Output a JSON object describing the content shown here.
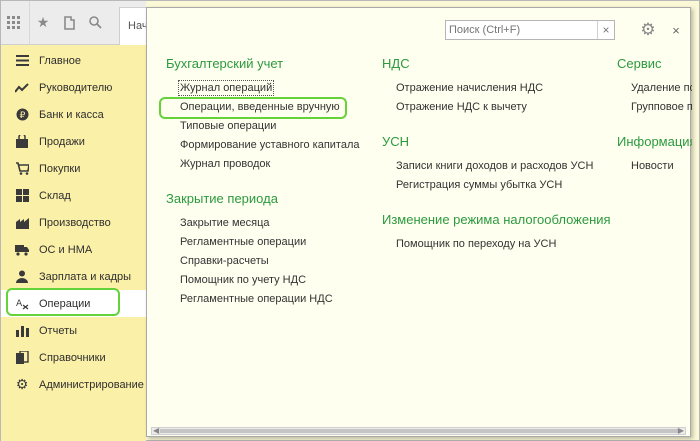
{
  "toolbar": {
    "icons": [
      "grid-icon",
      "star-icon",
      "history-icon",
      "search-icon"
    ],
    "tab_label": "Нач"
  },
  "sidebar": {
    "items": [
      {
        "label": "Главное",
        "icon": "menu-lines-icon"
      },
      {
        "label": "Руководителю",
        "icon": "trend-icon"
      },
      {
        "label": "Банк и касса",
        "icon": "coin-icon"
      },
      {
        "label": "Продажи",
        "icon": "bag-icon"
      },
      {
        "label": "Покупки",
        "icon": "cart-icon"
      },
      {
        "label": "Склад",
        "icon": "warehouse-icon"
      },
      {
        "label": "Производство",
        "icon": "factory-icon"
      },
      {
        "label": "ОС и НМА",
        "icon": "truck-icon"
      },
      {
        "label": "Зарплата и кадры",
        "icon": "person-icon"
      },
      {
        "label": "Операции",
        "icon": "operations-icon"
      },
      {
        "label": "Отчеты",
        "icon": "bar-chart-icon"
      },
      {
        "label": "Справочники",
        "icon": "books-icon"
      },
      {
        "label": "Администрирование",
        "icon": "gear-icon"
      }
    ],
    "active": "Операции"
  },
  "panel": {
    "search_placeholder": "Поиск (Ctrl+F)",
    "clear_symbol": "×",
    "close_symbol": "×",
    "sections": {
      "accounting": {
        "title": "Бухгалтерский учет",
        "links": [
          "Журнал операций",
          "Операции, введенные вручную",
          "Типовые операции",
          "Формирование уставного капитала",
          "Журнал проводок"
        ]
      },
      "period_close": {
        "title": "Закрытие периода",
        "links": [
          "Закрытие месяца",
          "Регламентные операции",
          "Справки-расчеты",
          "Помощник по учету НДС",
          "Регламентные операции НДС"
        ]
      },
      "vat": {
        "title": "НДС",
        "links": [
          "Отражение начисления НДС",
          "Отражение НДС к вычету"
        ]
      },
      "usn": {
        "title": "УСН",
        "links": [
          "Записи книги доходов и расходов УСН",
          "Регистрация суммы убытка УСН"
        ]
      },
      "tax_mode": {
        "title": "Изменение режима налогообложения",
        "links": [
          "Помощник по переходу на УСН"
        ]
      },
      "service": {
        "title": "Сервис",
        "links": [
          "Удаление пом",
          "Групповое пе"
        ]
      },
      "info": {
        "title": "Информация",
        "links": [
          "Новости"
        ]
      }
    }
  },
  "colors": {
    "sidebar_bg": "#fbf0a8",
    "panel_bg": "#fffff0",
    "header_green": "#2b9a3f",
    "highlight_green": "#66d23a"
  }
}
